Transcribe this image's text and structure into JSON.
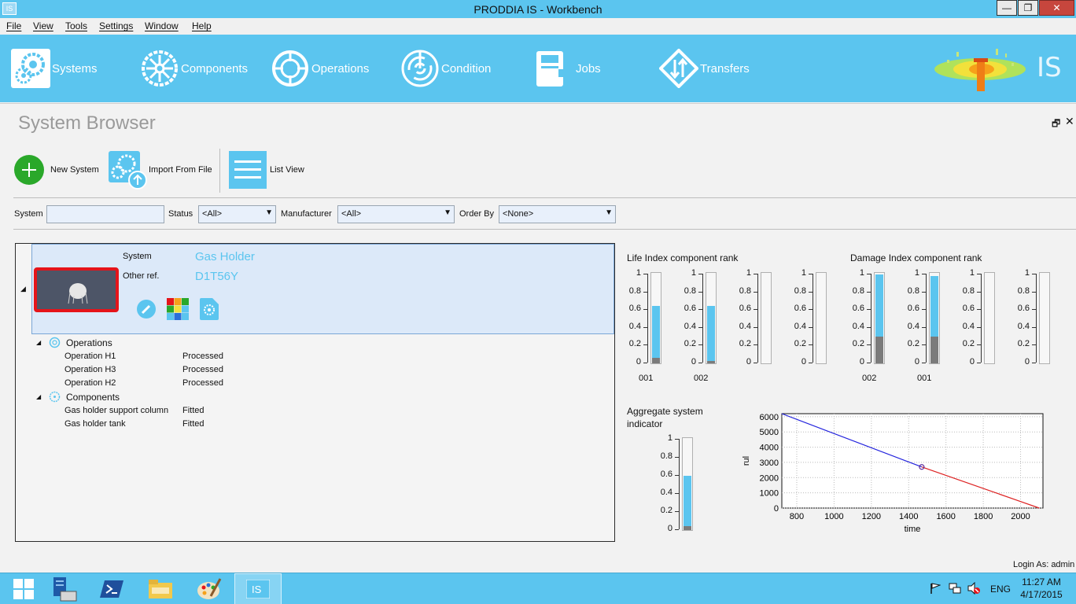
{
  "window": {
    "icon_text": "IS",
    "title": "PRODDIA IS - Workbench",
    "minimize": "—",
    "maximize": "❐",
    "close": "✕"
  },
  "menu": [
    "File",
    "View",
    "Tools",
    "Settings",
    "Window",
    "Help"
  ],
  "ribbon": {
    "items": [
      {
        "label": "Systems",
        "icon": "gears-icon"
      },
      {
        "label": "Components",
        "icon": "wheel-icon"
      },
      {
        "label": "Operations",
        "icon": "crosshair-icon"
      },
      {
        "label": "Condition",
        "icon": "radar-icon"
      },
      {
        "label": "Jobs",
        "icon": "clipboard-icon"
      },
      {
        "label": "Transfers",
        "icon": "transfer-icon"
      }
    ],
    "brand_text": "IS"
  },
  "panel": {
    "title": "System Browser",
    "restore": "🗗",
    "close": "✕"
  },
  "toolbar": {
    "new_system": "New System",
    "import_from_file": "Import From File",
    "list_view": "List View"
  },
  "filters": {
    "system_label": "System",
    "system_value": "",
    "status_label": "Status",
    "status_value": "<All>",
    "manufacturer_label": "Manufacturer",
    "manufacturer_value": "<All>",
    "order_by_label": "Order By",
    "order_by_value": "<None>"
  },
  "system_card": {
    "system_label": "System",
    "system_value": "Gas Holder",
    "other_ref_label": "Other ref.",
    "other_ref_value": "D1T56Y"
  },
  "tree": {
    "operations_label": "Operations",
    "operations": [
      {
        "name": "Operation H1",
        "status": "Processed"
      },
      {
        "name": "Operation H3",
        "status": "Processed"
      },
      {
        "name": "Operation H2",
        "status": "Processed"
      }
    ],
    "components_label": "Components",
    "components": [
      {
        "name": "Gas holder support column",
        "status": "Fitted"
      },
      {
        "name": "Gas holder tank",
        "status": "Fitted"
      }
    ]
  },
  "chart_data": [
    {
      "type": "bar",
      "title": "Life Index component rank",
      "categories": [
        "001",
        "002",
        "",
        ""
      ],
      "values": [
        0.65,
        0.65,
        0,
        0
      ],
      "base_values": [
        0.06,
        0.03,
        0,
        0
      ],
      "ylim": [
        0,
        1
      ],
      "yticks": [
        "1",
        "0.8",
        "0.6",
        "0.4",
        "0.2",
        "0"
      ]
    },
    {
      "type": "bar",
      "title": "Damage Index component rank",
      "categories": [
        "002",
        "001",
        "",
        ""
      ],
      "values": [
        1.0,
        0.98,
        0,
        0
      ],
      "base_values": [
        0.3,
        0.3,
        0,
        0
      ],
      "ylim": [
        0,
        1
      ],
      "yticks": [
        "1",
        "0.8",
        "0.6",
        "0.4",
        "0.2",
        "0"
      ]
    },
    {
      "type": "bar",
      "title": "Aggregate system indicator",
      "categories": [
        ""
      ],
      "values": [
        0.6
      ],
      "base_values": [
        0.04
      ],
      "ylim": [
        0,
        1
      ],
      "yticks": [
        "1",
        "0.8",
        "0.6",
        "0.4",
        "0.2",
        "0"
      ]
    },
    {
      "type": "line",
      "xlabel": "time",
      "ylabel": "rul",
      "xlim": [
        720,
        2120
      ],
      "ylim": [
        0,
        6200
      ],
      "xticks": [
        800,
        1000,
        1200,
        1400,
        1600,
        1800,
        2000
      ],
      "yticks": [
        0,
        1000,
        2000,
        3000,
        4000,
        5000,
        6000
      ],
      "series": [
        {
          "color": "#2222dd",
          "points": [
            [
              720,
              6200
            ],
            [
              1470,
              2700
            ]
          ]
        },
        {
          "color": "#dd2222",
          "points": [
            [
              1470,
              2700
            ],
            [
              2100,
              0
            ]
          ]
        }
      ],
      "marker": [
        1470,
        2700
      ],
      "grid": true
    }
  ],
  "status": {
    "login": "Login As: admin"
  },
  "taskbar": {
    "apps": [
      "windows-start-icon",
      "server-manager-icon",
      "powershell-icon",
      "file-explorer-icon",
      "paint-icon",
      "proddia-is-icon"
    ],
    "lang": "ENG",
    "time": "11:27 AM",
    "date": "4/17/2015"
  },
  "colors": {
    "accent": "#5bc5ef",
    "green": "#2aa82a",
    "selection": "#dce9f9",
    "thumb_border": "#e5141a"
  }
}
